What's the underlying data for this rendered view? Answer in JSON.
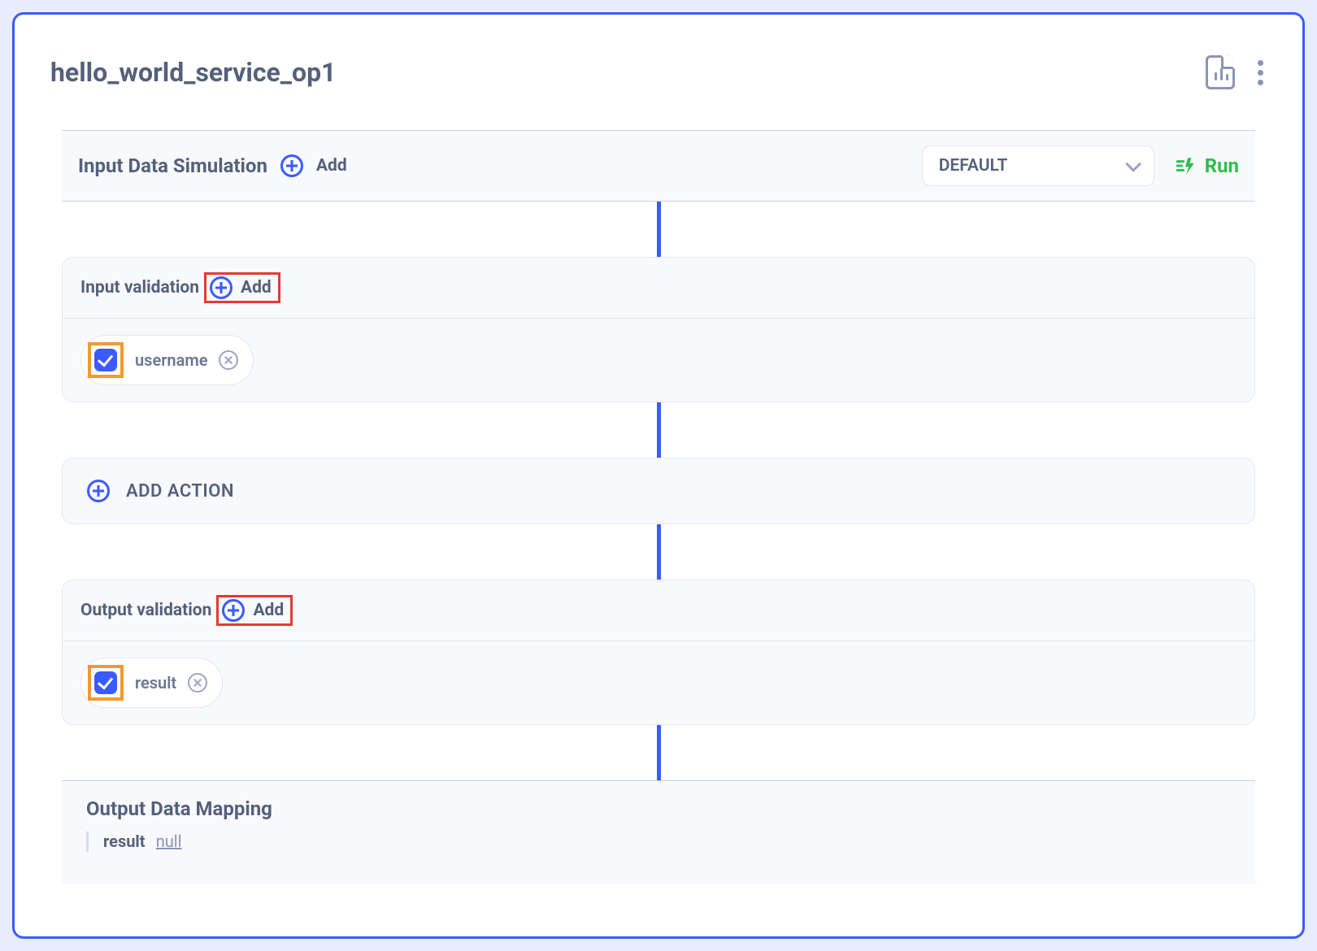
{
  "header": {
    "title": "hello_world_service_op1"
  },
  "sim": {
    "title": "Input Data Simulation",
    "add_label": "Add",
    "dropdown_selected": "DEFAULT",
    "run_label": "Run"
  },
  "input_validation": {
    "title": "Input validation",
    "add_label": "Add",
    "chip_label": "username"
  },
  "add_action": {
    "label": "ADD ACTION"
  },
  "output_validation": {
    "title": "Output validation",
    "add_label": "Add",
    "chip_label": "result"
  },
  "mapping": {
    "title": "Output Data Mapping",
    "key": "result",
    "value": "null"
  }
}
